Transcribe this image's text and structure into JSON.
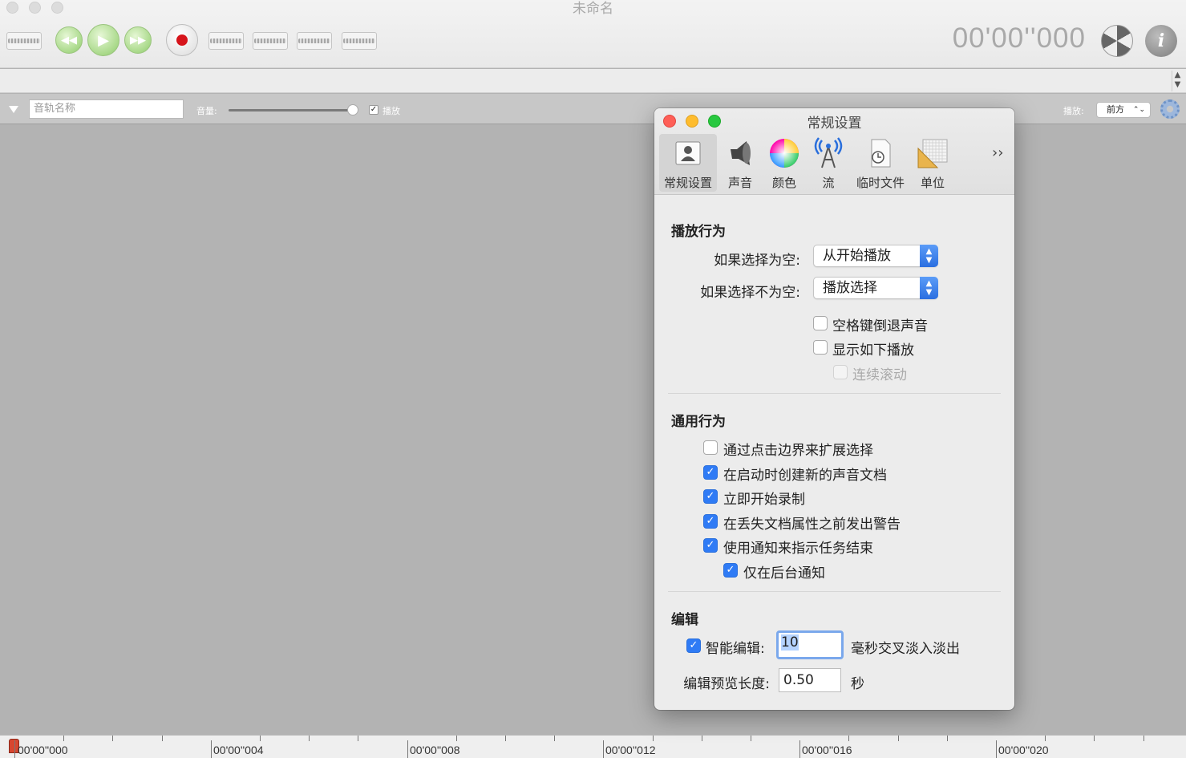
{
  "window": {
    "title": "未命名",
    "timer": "00'00''000"
  },
  "trackbar": {
    "name_placeholder": "音轨名称",
    "volume_label": "音量:",
    "volume_level": 0.95,
    "play_checkbox_label": "播放",
    "play_checked": true,
    "playback_label": "播放:",
    "playback_value": "前方"
  },
  "ruler": {
    "labels": [
      "00'00''000",
      "00'00''004",
      "00'00''008",
      "00'00''012",
      "00'00''016",
      "00'00''020"
    ]
  },
  "dialog": {
    "title": "常规设置",
    "tabs": [
      "常规设置",
      "声音",
      "颜色",
      "流",
      "临时文件",
      "单位"
    ],
    "more_label": "››",
    "playback_section": {
      "title": "播放行为",
      "empty_label": "如果选择为空:",
      "empty_value": "从开始播放",
      "nonempty_label": "如果选择不为空:",
      "nonempty_value": "播放选择",
      "space_reverse": {
        "label": "空格键倒退声音",
        "checked": false
      },
      "show_follow": {
        "label": "显示如下播放",
        "checked": false
      },
      "continuous_scroll": {
        "label": "连续滚动",
        "checked": false
      }
    },
    "general_section": {
      "title": "通用行为",
      "extend_selection": {
        "label": "通过点击边界来扩展选择",
        "checked": false
      },
      "new_doc_on_start": {
        "label": "在启动时创建新的声音文档",
        "checked": true
      },
      "record_immediately": {
        "label": "立即开始录制",
        "checked": true
      },
      "warn_before_loss": {
        "label": "在丢失文档属性之前发出警告",
        "checked": true
      },
      "notify_task_end": {
        "label": "使用通知来指示任务结束",
        "checked": true
      },
      "notify_background_only": {
        "label": "仅在后台通知",
        "checked": true
      }
    },
    "edit_section": {
      "title": "编辑",
      "smart_edit_label": "智能编辑:",
      "smart_edit_checked": true,
      "smart_edit_value": "10",
      "crossfade_unit": "毫秒交叉淡入淡出",
      "preview_label": "编辑预览长度:",
      "preview_value": "0.50",
      "preview_unit": "秒"
    }
  }
}
